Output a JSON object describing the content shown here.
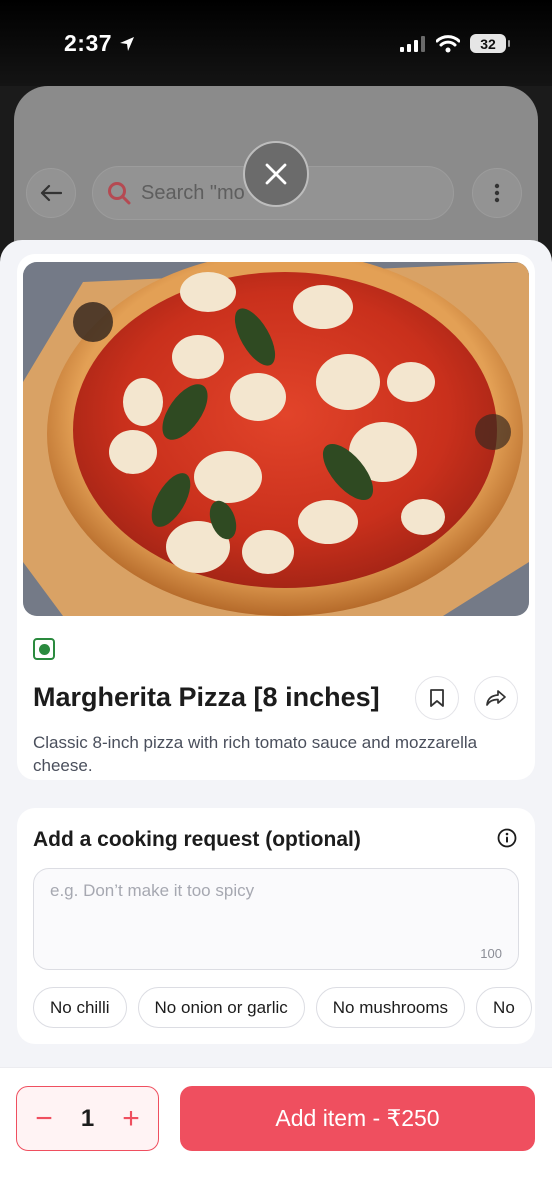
{
  "status_bar": {
    "time": "2:37",
    "battery": "32"
  },
  "background_page": {
    "search_placeholder": "Search \"mo"
  },
  "item": {
    "name": "Margherita Pizza [8 inches]",
    "description": "Classic 8-inch pizza with rich tomato sauce and mozzarella cheese.",
    "veg_color": "#2a8a3e"
  },
  "cooking_request": {
    "title": "Add a cooking request (optional)",
    "placeholder": "e.g. Don’t make it too spicy",
    "char_limit": "100",
    "chips": [
      "No chilli",
      "No onion or garlic",
      "No mushrooms",
      "No"
    ]
  },
  "cart": {
    "minus": "−",
    "quantity": "1",
    "plus": "+",
    "add_label": "Add item - ₹250"
  },
  "colors": {
    "accent": "#ef4f5f",
    "sheet_bg": "#f3f4f8"
  }
}
